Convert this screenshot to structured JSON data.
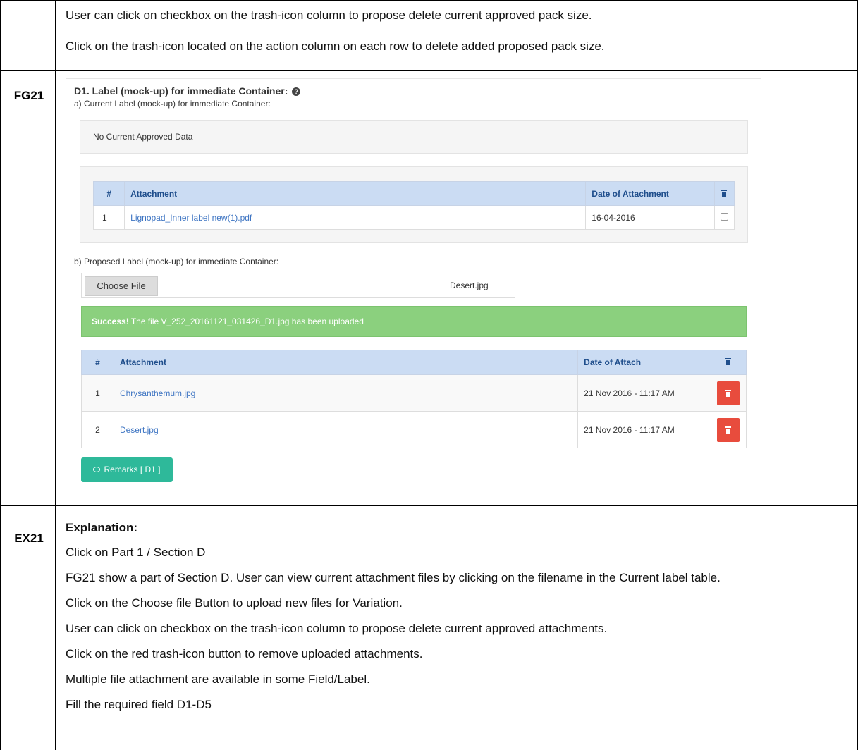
{
  "rows": {
    "top": {
      "lines": [
        "User can click on checkbox on the trash-icon column to propose delete current approved pack size.",
        "Click on the trash-icon located on the action column on  each row to delete added proposed pack size."
      ]
    },
    "fg": {
      "label": "FG21",
      "section_title": "D1. Label (mock-up) for immediate Container:",
      "current_label": "a) Current Label (mock-up) for immediate Container:",
      "no_data_text": "No Current Approved Data",
      "current_table": {
        "headers": [
          "#",
          "Attachment",
          "Date of Attachment"
        ],
        "rows": [
          {
            "num": "1",
            "file": "Lignopad_Inner label new(1).pdf",
            "date": "16-04-2016"
          }
        ]
      },
      "proposed_label": "b) Proposed Label (mock-up) for immediate Container:",
      "file_input": {
        "button": "Choose File",
        "filename": "Desert.jpg"
      },
      "alert": {
        "strong": "Success!",
        "text": " The file V_252_20161121_031426_D1.jpg has been uploaded"
      },
      "proposed_table": {
        "headers": [
          "#",
          "Attachment",
          "Date of Attach"
        ],
        "rows": [
          {
            "num": "1",
            "file": "Chrysanthemum.jpg",
            "date": "21 Nov 2016 - 11:17 AM"
          },
          {
            "num": "2",
            "file": "Desert.jpg",
            "date": "21 Nov 2016 - 11:17 AM"
          }
        ]
      },
      "remarks_button": "Remarks [ D1 ]"
    },
    "ex": {
      "label": "EX21",
      "title": "Explanation:",
      "lines": [
        "Click on Part 1 / Section D",
        "FG21 show a part of Section D. User can view current attachment files by clicking on the filename in the Current label table.",
        "Click on the Choose file Button to upload new files for Variation.",
        "User can click on checkbox on the trash-icon column to propose delete current approved attachments.",
        "Click on the red trash-icon button to remove uploaded attachments.",
        "Multiple file attachment are available in some Field/Label.",
        "Fill the required field D1-D5"
      ]
    }
  },
  "colors": {
    "header_bg": "#cbdcf3",
    "link": "#3d74c2",
    "success": "#8bd07e",
    "danger": "#e84c3d",
    "remarks": "#2eb99a"
  }
}
